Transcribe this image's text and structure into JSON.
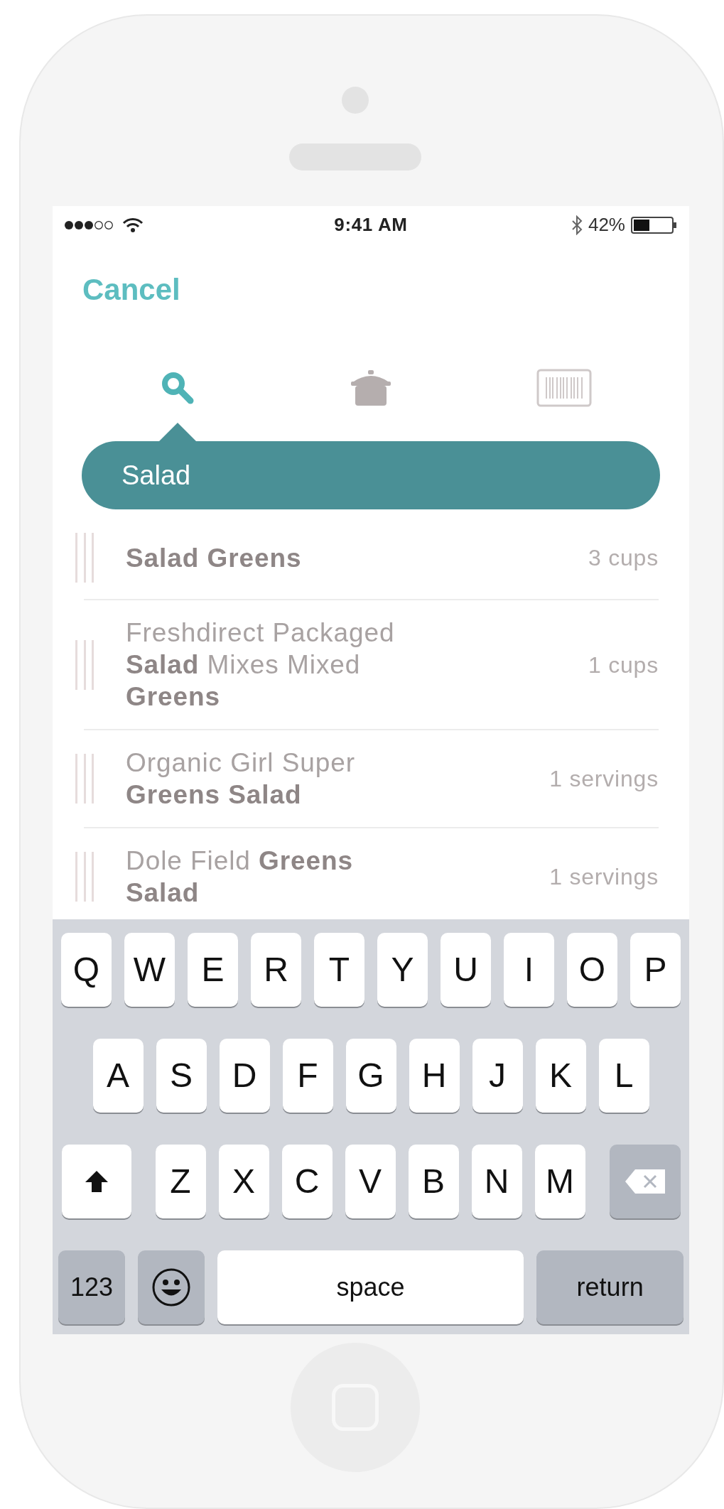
{
  "status_bar": {
    "time": "9:41 AM",
    "battery": "42%"
  },
  "nav": {
    "cancel": "Cancel"
  },
  "tabs": [
    {
      "kind": "search",
      "selected": true
    },
    {
      "kind": "pot",
      "selected": false
    },
    {
      "kind": "barcode",
      "selected": false
    }
  ],
  "search": {
    "value": "Salad"
  },
  "results": [
    {
      "name": "**Salad Greens**",
      "amount": "3 cups"
    },
    {
      "name": "Freshdirect Packaged **Salad** Mixes Mixed **Greens**",
      "amount": "1 cups"
    },
    {
      "name": "Organic Girl Super **Greens Salad**",
      "amount": "1 servings"
    },
    {
      "name": "Dole Field **Greens Salad**",
      "amount": "1 servings"
    }
  ],
  "keyboard": {
    "key_rows": [
      {
        "keys": [
          {
            "kind": "letter",
            "label": "Q"
          },
          {
            "kind": "letter",
            "label": "W"
          },
          {
            "kind": "letter",
            "label": "E"
          },
          {
            "kind": "letter",
            "label": "R"
          },
          {
            "kind": "letter",
            "label": "T"
          },
          {
            "kind": "letter",
            "label": "Y"
          },
          {
            "kind": "letter",
            "label": "U"
          },
          {
            "kind": "letter",
            "label": "I"
          },
          {
            "kind": "letter",
            "label": "O"
          },
          {
            "kind": "letter",
            "label": "P"
          }
        ]
      },
      {
        "keys": [
          {
            "kind": "letter",
            "label": "A"
          },
          {
            "kind": "letter",
            "label": "S"
          },
          {
            "kind": "letter",
            "label": "D"
          },
          {
            "kind": "letter",
            "label": "F"
          },
          {
            "kind": "letter",
            "label": "G"
          },
          {
            "kind": "letter",
            "label": "H"
          },
          {
            "kind": "letter",
            "label": "J"
          },
          {
            "kind": "letter",
            "label": "K"
          },
          {
            "kind": "letter",
            "label": "L"
          }
        ]
      },
      {
        "keys": [
          {
            "kind": "shift"
          },
          {
            "kind": "letter",
            "label": "Z"
          },
          {
            "kind": "letter",
            "label": "X"
          },
          {
            "kind": "letter",
            "label": "C"
          },
          {
            "kind": "letter",
            "label": "V"
          },
          {
            "kind": "letter",
            "label": "B"
          },
          {
            "kind": "letter",
            "label": "N"
          },
          {
            "kind": "letter",
            "label": "M"
          },
          {
            "kind": "delete"
          }
        ]
      },
      {
        "keys": [
          {
            "kind": "mode",
            "label": "123"
          },
          {
            "kind": "emoji"
          },
          {
            "kind": "space",
            "label": "space"
          },
          {
            "kind": "return",
            "label": "return"
          }
        ]
      }
    ]
  }
}
